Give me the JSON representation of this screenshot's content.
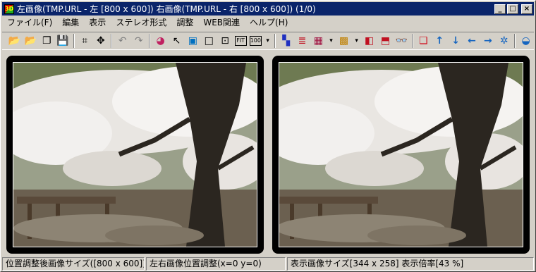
{
  "window": {
    "title": "左画像(TMP.URL - 左 [800 x 600]) 右画像(TMP.URL - 右 [800 x 600])  (1/0)",
    "app_icon_text": "3D",
    "controls": {
      "minimize": "_",
      "maximize": "□",
      "close": "×"
    }
  },
  "menu": {
    "items": [
      "ファイル(F)",
      "編集",
      "表示",
      "ステレオ形式",
      "調整",
      "WEB関連",
      "ヘルプ(H)"
    ]
  },
  "toolbar": {
    "buttons": [
      {
        "name": "open-folder-icon",
        "glyph": "📂"
      },
      {
        "name": "open-web-icon",
        "glyph": "📂"
      },
      {
        "name": "copy-window-icon",
        "glyph": "❐"
      },
      {
        "name": "save-icon",
        "glyph": "💾"
      },
      {
        "name": "crop-icon",
        "glyph": "⌗"
      },
      {
        "name": "move-icon",
        "glyph": "✥"
      },
      {
        "name": "undo-icon",
        "glyph": "↶"
      },
      {
        "name": "redo-icon",
        "glyph": "↷"
      },
      {
        "name": "color-wheel-icon",
        "glyph": "◕"
      },
      {
        "name": "pointer-icon",
        "glyph": "↖"
      },
      {
        "name": "fit-frame-icon",
        "glyph": "▣"
      },
      {
        "name": "frame-icon",
        "glyph": "□"
      },
      {
        "name": "full-icon",
        "glyph": "⊡"
      },
      {
        "name": "fit-label-icon",
        "glyph": "FIT"
      },
      {
        "name": "zoom-100-icon",
        "glyph": "100"
      },
      {
        "name": "anaglyph-icon",
        "glyph": "▚"
      },
      {
        "name": "line-interlace-icon",
        "glyph": "≣"
      },
      {
        "name": "checker-icon",
        "glyph": "▦"
      },
      {
        "name": "mosaic-icon",
        "glyph": "▩"
      },
      {
        "name": "split-lr-icon",
        "glyph": "◧"
      },
      {
        "name": "split-tb-icon",
        "glyph": "⬒"
      },
      {
        "name": "glasses-icon",
        "glyph": "👓"
      },
      {
        "name": "swap-icon",
        "glyph": "❏"
      },
      {
        "name": "arrow-up-icon",
        "glyph": "↑"
      },
      {
        "name": "arrow-down-icon",
        "glyph": "↓"
      },
      {
        "name": "arrow-left-icon",
        "glyph": "←"
      },
      {
        "name": "arrow-right-icon",
        "glyph": "→"
      },
      {
        "name": "center-icon",
        "glyph": "✲"
      },
      {
        "name": "disc-icon",
        "glyph": "◒"
      }
    ]
  },
  "status": {
    "field1": "位置調整後画像サイズ([800 x 600])",
    "field2": "左右画像位置調整(x=0 y=0)",
    "field3": "表示画像サイズ[344 x 258]  表示倍率[43 %]"
  },
  "colors": {
    "titlebar": "#0a246a",
    "face": "#d4d0c8",
    "panel_bg": "#000000"
  }
}
